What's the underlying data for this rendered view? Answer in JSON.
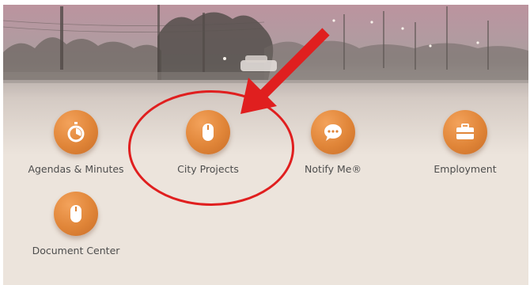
{
  "tiles": [
    {
      "id": "agendas",
      "label": "Agendas & Minutes",
      "icon": "stopwatch-icon"
    },
    {
      "id": "city-projects",
      "label": "City Projects",
      "icon": "mouse-icon"
    },
    {
      "id": "notify-me",
      "label": "Notify Me®",
      "icon": "speech-bubble-icon"
    },
    {
      "id": "employment",
      "label": "Employment",
      "icon": "toolbox-icon"
    },
    {
      "id": "document-center",
      "label": "Document Center",
      "icon": "mouse-icon"
    }
  ],
  "colors": {
    "tile_orange": "#e08538",
    "background": "#ece4dc",
    "label_text": "#4d4d4d",
    "annotation_red": "#e01f1f"
  }
}
